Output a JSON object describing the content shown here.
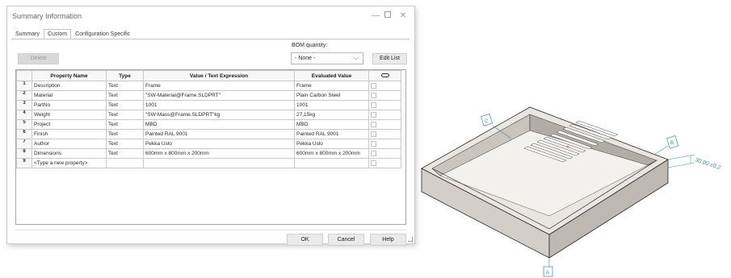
{
  "window": {
    "title": "Summary Information",
    "controls": {
      "minimize": "—",
      "close": "✕"
    }
  },
  "tabs": [
    {
      "label": "Summary",
      "active": false
    },
    {
      "label": "Custom",
      "active": true
    },
    {
      "label": "Configuration Specific",
      "active": false
    }
  ],
  "toolbar": {
    "delete_label": "Delete",
    "bom_label": "BOM quantity:",
    "bom_value": "- None -",
    "edit_list_label": "Edit List"
  },
  "grid": {
    "columns": [
      "Property Name",
      "Type",
      "Value / Text Expression",
      "Evaluated Value"
    ],
    "link_column_icon": "link-icon",
    "rows": [
      {
        "num": "1",
        "name": "Description",
        "type": "Text",
        "value": "Frame",
        "evaluated": "Frame"
      },
      {
        "num": "2",
        "name": "Material",
        "type": "Text",
        "value": "\"SW-Material@Frame.SLDPRT\"",
        "evaluated": "Plain Carbon Steel"
      },
      {
        "num": "3",
        "name": "PartNo",
        "type": "Text",
        "value": "1001",
        "evaluated": "1001"
      },
      {
        "num": "4",
        "name": "Weight",
        "type": "Text",
        "value": "\"SW-Mass@Frame.SLDPRT\"kg",
        "evaluated": "27,15kg"
      },
      {
        "num": "5",
        "name": "Project",
        "type": "Text",
        "value": "MBD",
        "evaluated": "MBD"
      },
      {
        "num": "6",
        "name": "Finish",
        "type": "Text",
        "value": "Painted RAL 9001",
        "evaluated": "Painted RAL 9001"
      },
      {
        "num": "7",
        "name": "Author",
        "type": "Text",
        "value": "Pekka Uslo",
        "evaluated": "Pekka Uslo"
      },
      {
        "num": "8",
        "name": "Dimensions",
        "type": "Text",
        "value": "600mm x 800mm x 200mm",
        "evaluated": "600mm x 800mm x 200mm"
      },
      {
        "num": "9",
        "name": "<Type a new property>",
        "type": "",
        "value": "",
        "evaluated": ""
      }
    ]
  },
  "footer": {
    "ok_label": "OK",
    "cancel_label": "Cancel",
    "help_label": "Help"
  },
  "drawing": {
    "callouts": [
      "A",
      "B",
      "C"
    ],
    "dimension_text": "30.00 ±0.2",
    "colors": {
      "annotation": "#3c8a95",
      "body": "#cfcac4",
      "outline": "#2b2b2b"
    }
  }
}
